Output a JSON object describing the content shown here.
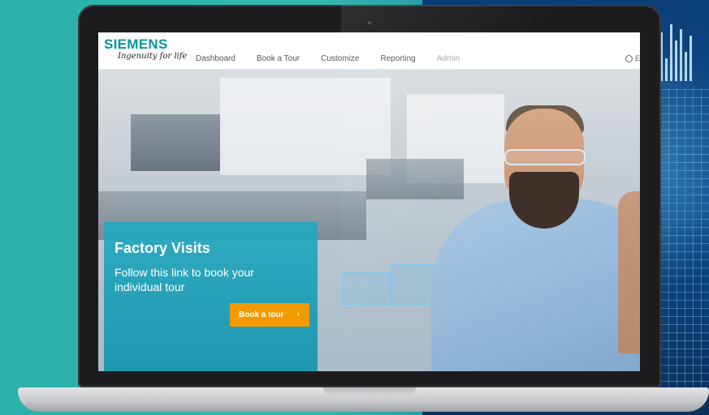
{
  "brand": {
    "name": "SIEMENS",
    "tagline": "Ingenuity for life",
    "color": "#009999"
  },
  "nav": {
    "items": [
      {
        "label": "Dashboard"
      },
      {
        "label": "Book a Tour"
      },
      {
        "label": "Customize"
      },
      {
        "label": "Reporting"
      },
      {
        "label": "Admin"
      }
    ],
    "language": {
      "label": "E",
      "icon": "globe-icon"
    }
  },
  "hero": {
    "title": "Factory Visits",
    "text": "Follow this link to book your individual tour",
    "button": {
      "label": "Book a tour",
      "icon": "chevron-right-icon",
      "color": "#f29a00"
    }
  }
}
